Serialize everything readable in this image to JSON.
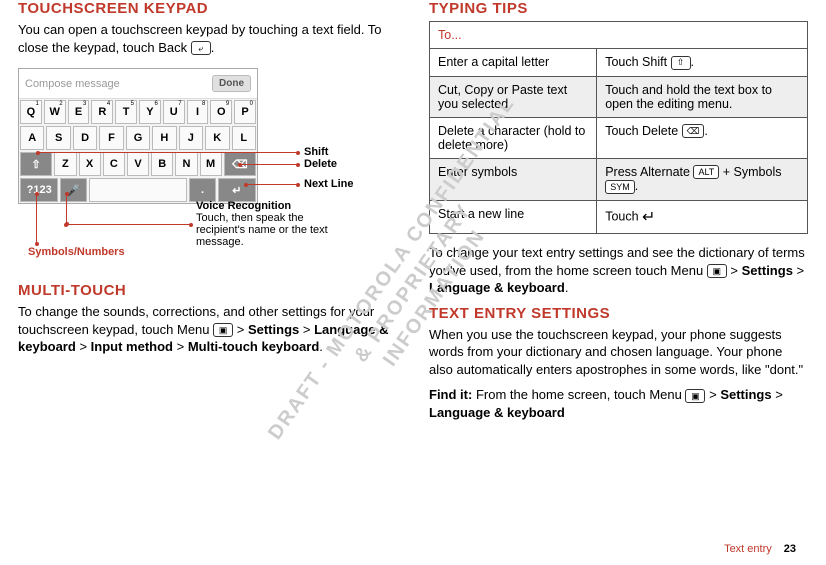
{
  "watermark": "DRAFT - MOTOROLA CONFIDENTIAL\n& PROPRIETARY\nINFORMATION",
  "left": {
    "h1": "TOUCHSCREEN KEYPAD",
    "p1_a": "You can open a touchscreen keypad by touching a text field. To close the keypad, touch Back ",
    "back_icon": "⤶",
    "p1_b": ".",
    "compose_placeholder": "Compose message",
    "done": "Done",
    "rows": {
      "r1": [
        "Q",
        "W",
        "E",
        "R",
        "T",
        "Y",
        "U",
        "I",
        "O",
        "P"
      ],
      "r1sup": [
        "1",
        "2",
        "3",
        "4",
        "5",
        "6",
        "7",
        "8",
        "9",
        "0"
      ],
      "r2": [
        "A",
        "S",
        "D",
        "F",
        "G",
        "H",
        "J",
        "K",
        "L"
      ],
      "r3_shift": "⇧",
      "r3": [
        "Z",
        "X",
        "C",
        "V",
        "B",
        "N",
        "M"
      ],
      "r3_del": "⌫",
      "r4_sym": "?123",
      "r4_mic": "🎤",
      "r4_space": " ",
      "r4_dot": ".",
      "r4_enter": "↵"
    },
    "callouts": {
      "shift": "Shift",
      "delete": "Delete",
      "next": "Next Line",
      "voice_t": "Voice Recognition",
      "voice_s": "Touch, then speak the recipient's name or the text message.",
      "symnum": "Symbols/Numbers"
    },
    "h2": "MULTI-TOUCH",
    "p2_a": "To change the sounds, corrections, and other settings for your touchscreen keypad, touch Menu ",
    "menu_icon": "▣",
    "p2_b": " > ",
    "p2_path": [
      "Settings",
      "Language & keyboard",
      "Input method",
      "Multi-touch keyboard"
    ],
    "gt": ">"
  },
  "right": {
    "h1": "TYPING TIPS",
    "th": "To...",
    "rows": [
      {
        "a": "Enter a capital letter",
        "b_pre": "Touch Shift ",
        "b_icon": "⇧",
        "b_post": "."
      },
      {
        "a": "Cut, Copy or Paste text you selected",
        "b": "Touch and hold the text box to open the editing menu.",
        "shade": true
      },
      {
        "a": "Delete a character (hold to delete more)",
        "b_pre": "Touch Delete ",
        "b_icon": "⌫",
        "b_post": "."
      },
      {
        "a": "Enter symbols",
        "b_pre": "Press Alternate ",
        "b_icon": "ALT",
        "b_mid": " + Symbols ",
        "b_icon2": "SYM",
        "b_post": ".",
        "shade": true
      },
      {
        "a": "Start a new line",
        "b_pre": "Touch ",
        "b_arrow": "↵"
      }
    ],
    "p1_a": "To change your text entry settings and see the dictionary of terms you've used, from the home screen touch Menu ",
    "menu_icon": "▣",
    "p1_b": " > ",
    "p1_path": [
      "Settings",
      "Language & keyboard"
    ],
    "h2": "TEXT ENTRY SETTINGS",
    "p2": "When you use the touchscreen keypad, your phone suggests words from your dictionary and chosen language. Your phone also automatically enters apostrophes in some words, like \"dont.\"",
    "p3_a": "Find it:",
    "p3_b": " From the home screen, touch Menu ",
    "p3_c": " > ",
    "p3_path": [
      "Settings",
      "Language & keyboard"
    ]
  },
  "footer": {
    "section": "Text entry",
    "page": "23"
  }
}
